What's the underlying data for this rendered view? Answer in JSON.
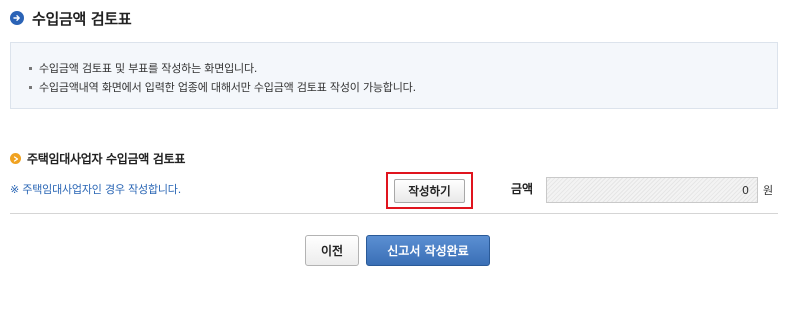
{
  "header": {
    "title": "수입금액 검토표",
    "icon": "arrow-right-circle-icon"
  },
  "info": {
    "lines": [
      "수입금액 검토표 및 부표를 작성하는 화면입니다.",
      "수입금액내역 화면에서 입력한 업종에 대해서만 수입금액 검토표 작성이 가능합니다."
    ]
  },
  "section": {
    "title": "주택임대사업자 수입금액 검토표",
    "icon": "bullet-circle-icon",
    "note": "※ 주택임대사업자인 경우 작성합니다.",
    "write_button_label": "작성하기",
    "amount_label": "금액",
    "amount_value": "0",
    "currency_unit": "원"
  },
  "footer": {
    "prev_label": "이전",
    "complete_label": "신고서 작성완료"
  },
  "colors": {
    "accent_blue": "#2b63b6",
    "section_icon_orange": "#f0a220",
    "highlight_red": "#e0141e",
    "note_blue": "#2a66b5",
    "primary_button": "#3a6fb6"
  }
}
